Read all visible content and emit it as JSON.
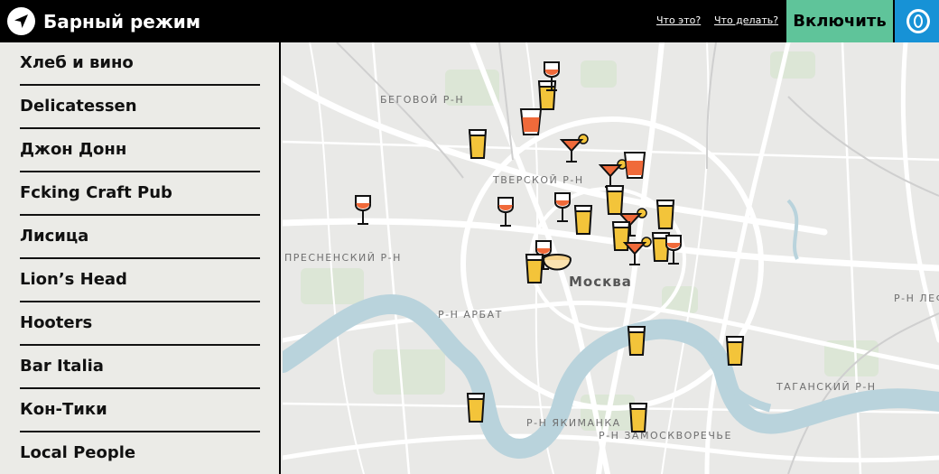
{
  "header": {
    "title": "Барный режим",
    "link_what": "Что это?",
    "link_todo": "Что делать?",
    "enable_label": "Включить"
  },
  "bars": [
    "Хлеб и вино",
    "Delicatessen",
    "Джон Донн",
    "Fcking Craft Pub",
    "Лисица",
    "Lion’s Head",
    "Hooters",
    "Bar Italia",
    "Кон-Тики",
    "Local People"
  ],
  "map": {
    "city": "Москва",
    "districts": {
      "begovoy": "БЕГОВОЙ Р-Н",
      "tverskoy": "ТВЕРСКОЙ Р-Н",
      "presnensky": "ПРЕСНЕНСКИЙ Р-Н",
      "arbat": "Р-Н АРБАТ",
      "tagansky": "ТАГАНСКИЙ Р-Н",
      "yakimanka": "Р-Н ЯКИМАНКА",
      "zamoskvorechye": "Р-Н ЗАМОСКВОРЕЧЬЕ",
      "lefortovo": "Р-Н ЛЕФО"
    },
    "marker_icons": {
      "beer": "beer-glass-icon",
      "wine": "wine-glass-icon",
      "cocktail": "cocktail-glass-icon",
      "shot": "shot-glass-icon",
      "bowl": "bowl-icon"
    },
    "colors": {
      "beer": "#f3c43a",
      "liquor": "#f06a3a",
      "river": "#b9d3dc",
      "park": "#d6e4cf"
    }
  }
}
